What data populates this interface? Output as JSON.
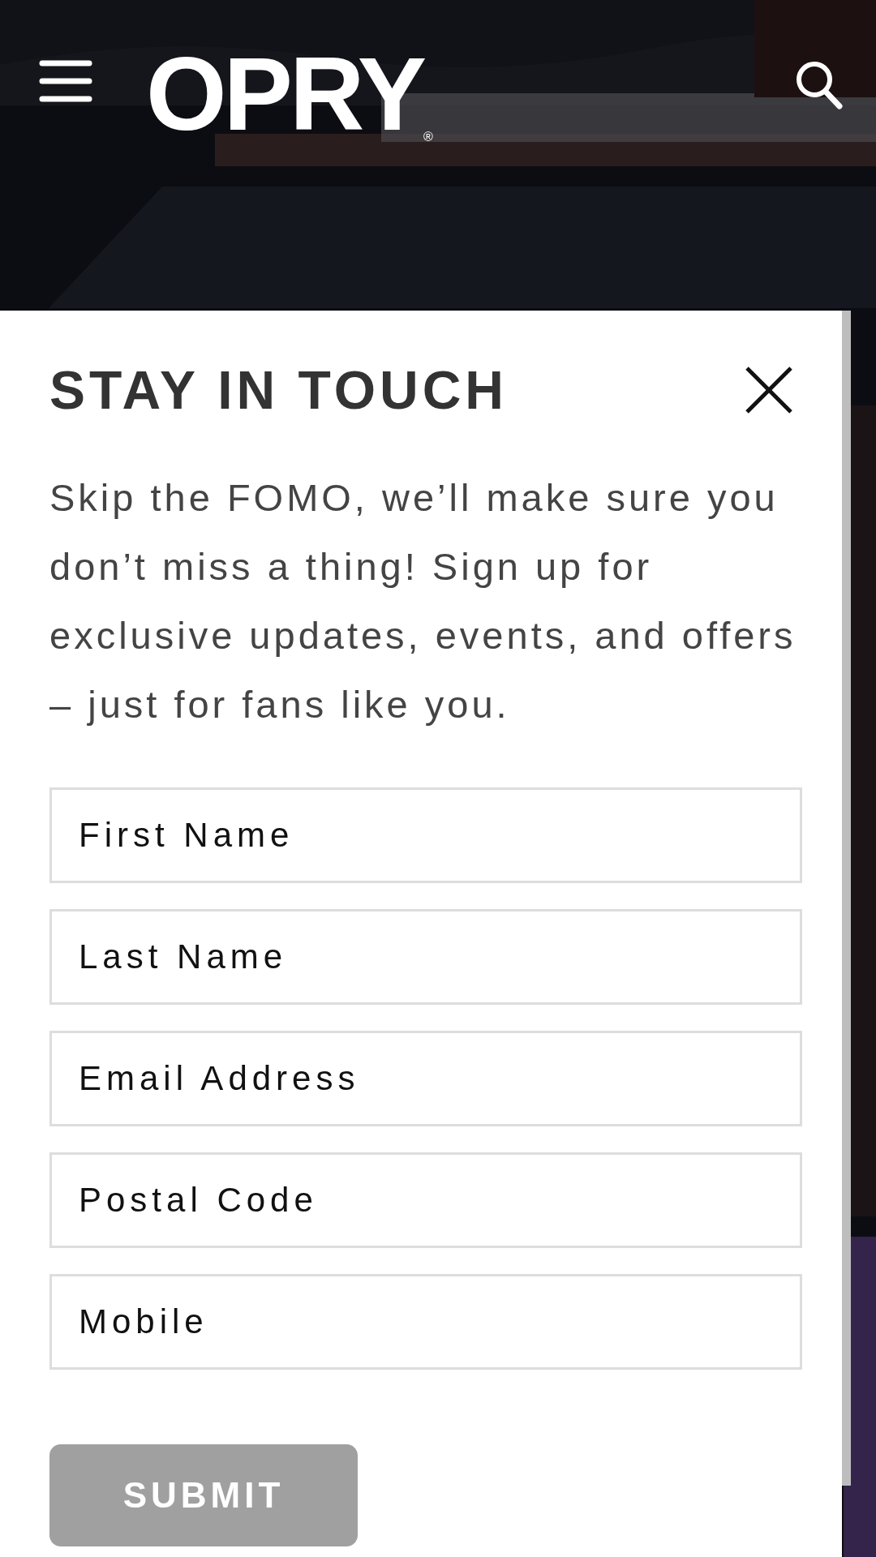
{
  "header": {
    "logo": {
      "name": "OPRY",
      "mark": "®"
    }
  },
  "popup": {
    "title": "STAY IN TOUCH",
    "description": "Skip the FOMO, we’ll make sure you don’t miss a thing! Sign up for exclusive updates, events, and offers – just for fans like you.",
    "fields": [
      {
        "placeholder": "First Name"
      },
      {
        "placeholder": "Last Name"
      },
      {
        "placeholder": "Email Address"
      },
      {
        "placeholder": "Postal Code"
      },
      {
        "placeholder": "Mobile"
      }
    ],
    "submit": {
      "label": "SUBMIT",
      "disabled": true
    }
  }
}
